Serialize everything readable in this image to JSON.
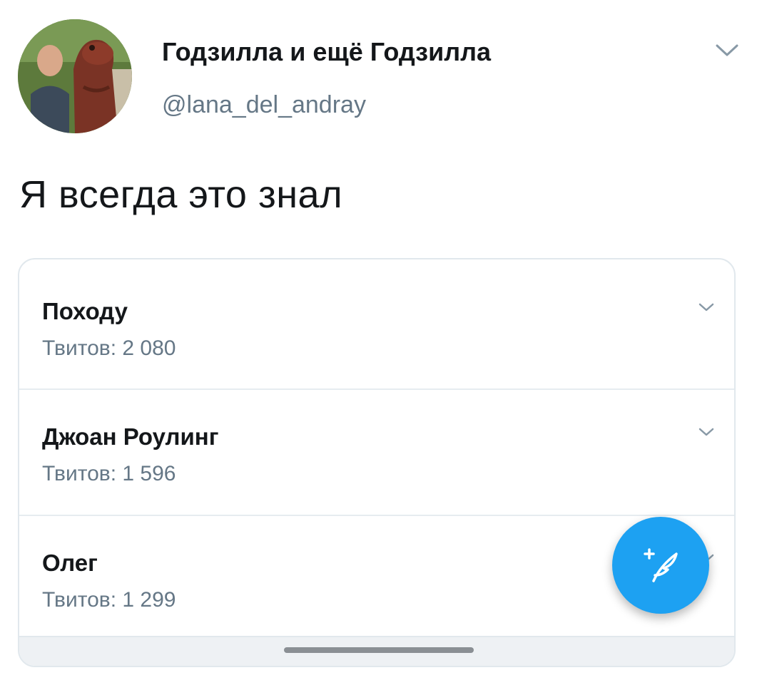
{
  "tweet": {
    "display_name": "Годзилла и ещё Годзилла",
    "handle": "@lana_del_andray",
    "text": "Я всегда это знал"
  },
  "embed": {
    "items": [
      {
        "name": "Походу",
        "count_label": "Твитов:",
        "count": "2 080"
      },
      {
        "name": "Джоан Роулинг",
        "count_label": "Твитов:",
        "count": "1 596"
      },
      {
        "name": "Олег",
        "count_label": "Твитов:",
        "count": "1 299"
      }
    ]
  },
  "icons": {
    "tweet_menu": "chevron-down-icon",
    "item_menu": "chevron-down-icon",
    "compose": "compose-tweet-icon"
  },
  "colors": {
    "accent": "#1da1f2",
    "secondary_text": "#657786",
    "primary_text": "#14171a",
    "border": "#e1e8ed"
  }
}
